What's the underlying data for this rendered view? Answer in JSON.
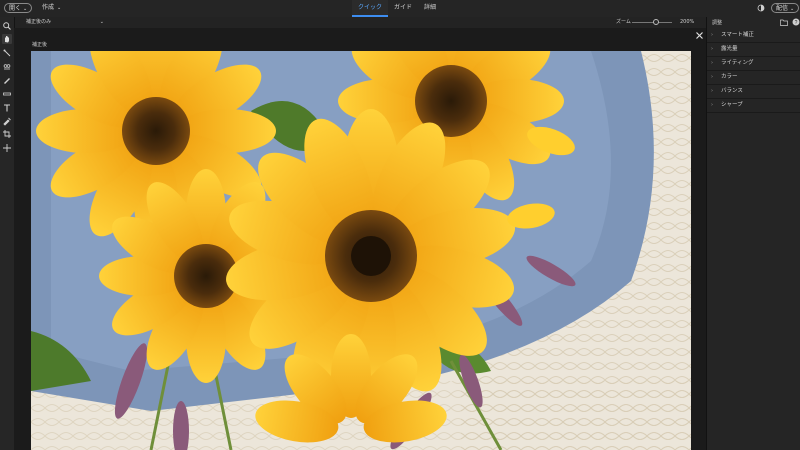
{
  "header": {
    "open_label": "開く",
    "create_label": "作成",
    "tabs": [
      {
        "label": "クイック",
        "active": true
      },
      {
        "label": "ガイド",
        "active": false
      },
      {
        "label": "詳細",
        "active": false
      }
    ],
    "share_label": "配信"
  },
  "view_bar": {
    "view_mode": "補正後のみ",
    "zoom_label": "ズーム",
    "zoom_value": "200%",
    "zoom_level_percent": 200
  },
  "canvas": {
    "after_label": "補正後"
  },
  "panel": {
    "title": "調整",
    "items": [
      {
        "label": "スマート補正"
      },
      {
        "label": "露光量"
      },
      {
        "label": "ライティング"
      },
      {
        "label": "カラー"
      },
      {
        "label": "バランス"
      },
      {
        "label": "シャープ"
      }
    ]
  },
  "tools": [
    "zoom-icon",
    "hand-icon",
    "quick-selection-icon",
    "eye-icon",
    "whiten-teeth-icon",
    "straighten-icon",
    "text-icon",
    "spot-healing-icon",
    "crop-icon",
    "move-icon"
  ],
  "colors": {
    "accent": "#3d8df0",
    "background": "#1e1e1e",
    "panel": "#252525"
  }
}
